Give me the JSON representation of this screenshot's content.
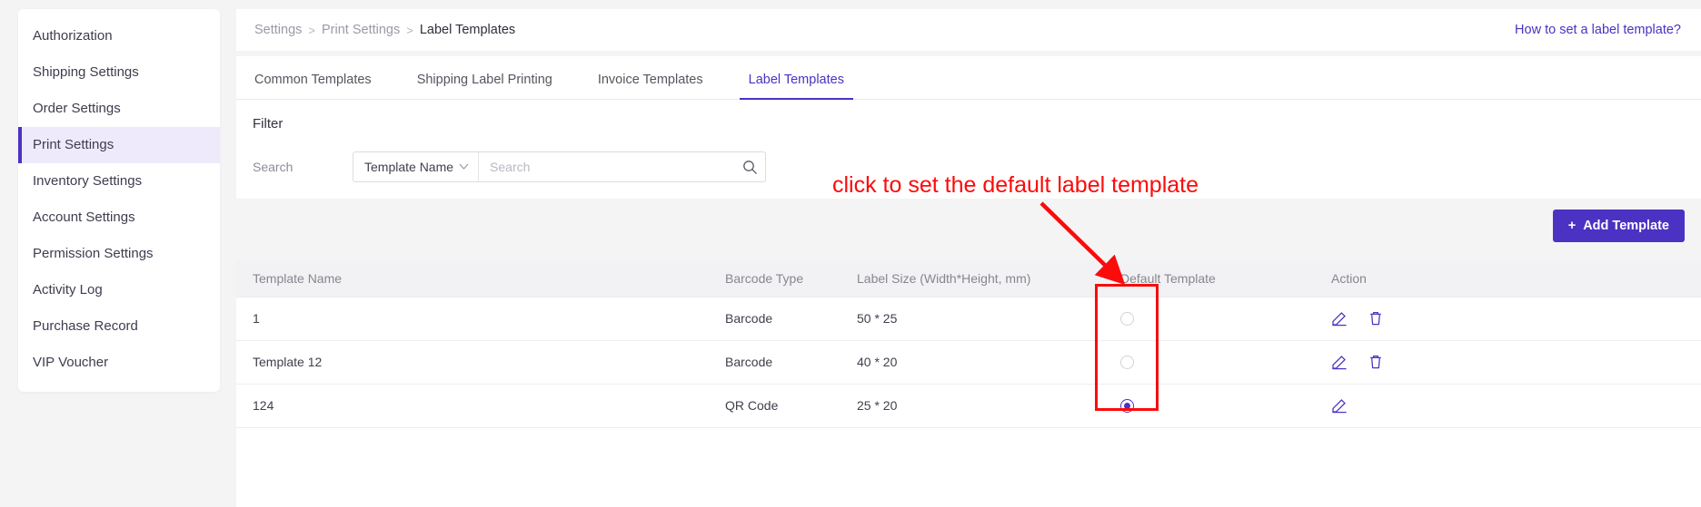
{
  "sidebar": {
    "items": [
      {
        "label": "Authorization",
        "active": false
      },
      {
        "label": "Shipping Settings",
        "active": false
      },
      {
        "label": "Order Settings",
        "active": false
      },
      {
        "label": "Print Settings",
        "active": true
      },
      {
        "label": "Inventory Settings",
        "active": false
      },
      {
        "label": "Account Settings",
        "active": false
      },
      {
        "label": "Permission Settings",
        "active": false
      },
      {
        "label": "Activity Log",
        "active": false
      },
      {
        "label": "Purchase Record",
        "active": false
      },
      {
        "label": "VIP Voucher",
        "active": false
      }
    ]
  },
  "breadcrumb": {
    "items": [
      "Settings",
      "Print Settings",
      "Label Templates"
    ],
    "separator": ">"
  },
  "help_link": "How to set a label template?",
  "tabs": [
    {
      "label": "Common Templates",
      "active": false
    },
    {
      "label": "Shipping Label Printing",
      "active": false
    },
    {
      "label": "Invoice Templates",
      "active": false
    },
    {
      "label": "Label Templates",
      "active": true
    }
  ],
  "filter": {
    "title": "Filter",
    "search_label": "Search",
    "field_select": "Template Name",
    "chevron": "⌄",
    "search_value": "",
    "search_placeholder": "Search",
    "search_icon": "search-icon"
  },
  "toolbar": {
    "add_plus": "+",
    "add_label": "Add Template"
  },
  "table": {
    "columns": [
      "Template Name",
      "Barcode Type",
      "Label Size (Width*Height, mm)",
      "Default Template",
      "Action"
    ],
    "rows": [
      {
        "name": "1",
        "barcode_type": "Barcode",
        "label_size": "50 * 25",
        "is_default": false,
        "actions": [
          "edit-icon",
          "delete-icon"
        ]
      },
      {
        "name": "Template 12",
        "barcode_type": "Barcode",
        "label_size": "40 * 20",
        "is_default": false,
        "actions": [
          "edit-icon",
          "delete-icon"
        ]
      },
      {
        "name": "124",
        "barcode_type": "QR Code",
        "label_size": "25 * 20",
        "is_default": true,
        "actions": [
          "edit-icon"
        ]
      }
    ]
  },
  "annotation": {
    "text": "click to set the default label template",
    "color": "#fb0b0b"
  },
  "colors": {
    "accent": "#4b32c3",
    "accent_soft": "#eeeafb",
    "page_bg": "#f4f4f5",
    "annotation_red": "#fb0b0b"
  }
}
